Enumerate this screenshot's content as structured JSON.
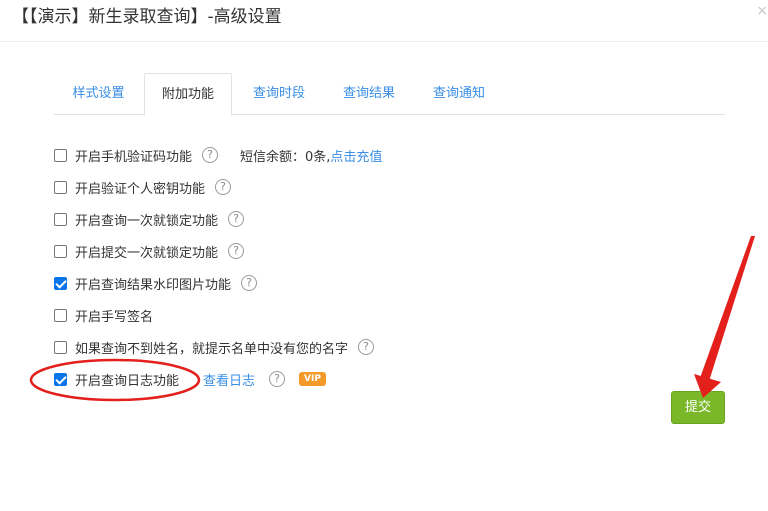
{
  "dialog": {
    "title": "【【演示】新生录取查询】-高级设置",
    "close_icon": "×"
  },
  "tabs": [
    {
      "label": "样式设置",
      "active": false
    },
    {
      "label": "附加功能",
      "active": true
    },
    {
      "label": "查询时段",
      "active": false
    },
    {
      "label": "查询结果",
      "active": false
    },
    {
      "label": "查询通知",
      "active": false
    }
  ],
  "options": [
    {
      "label": "开启手机验证码功能",
      "checked": false,
      "sms_label": "短信余额：0条,",
      "sms_link": "点击充值"
    },
    {
      "label": "开启验证个人密钥功能",
      "checked": false
    },
    {
      "label": "开启查询一次就锁定功能",
      "checked": false
    },
    {
      "label": "开启提交一次就锁定功能",
      "checked": false
    },
    {
      "label": "开启查询结果水印图片功能",
      "checked": true
    },
    {
      "label": "开启手写签名",
      "checked": false
    },
    {
      "label": "如果查询不到姓名，就提示名单中没有您的名字",
      "checked": false
    },
    {
      "label": "开启查询日志功能",
      "checked": true,
      "log_link": "查看日志",
      "badge": "VIP"
    }
  ],
  "help_glyph": "?",
  "submit_label": "提交",
  "colors": {
    "link": "#3a8ee6",
    "checkbox_checked": "#0a75e8",
    "submit": "#7ab829",
    "vip": "#f39a2b",
    "annotation": "#e3201b"
  }
}
